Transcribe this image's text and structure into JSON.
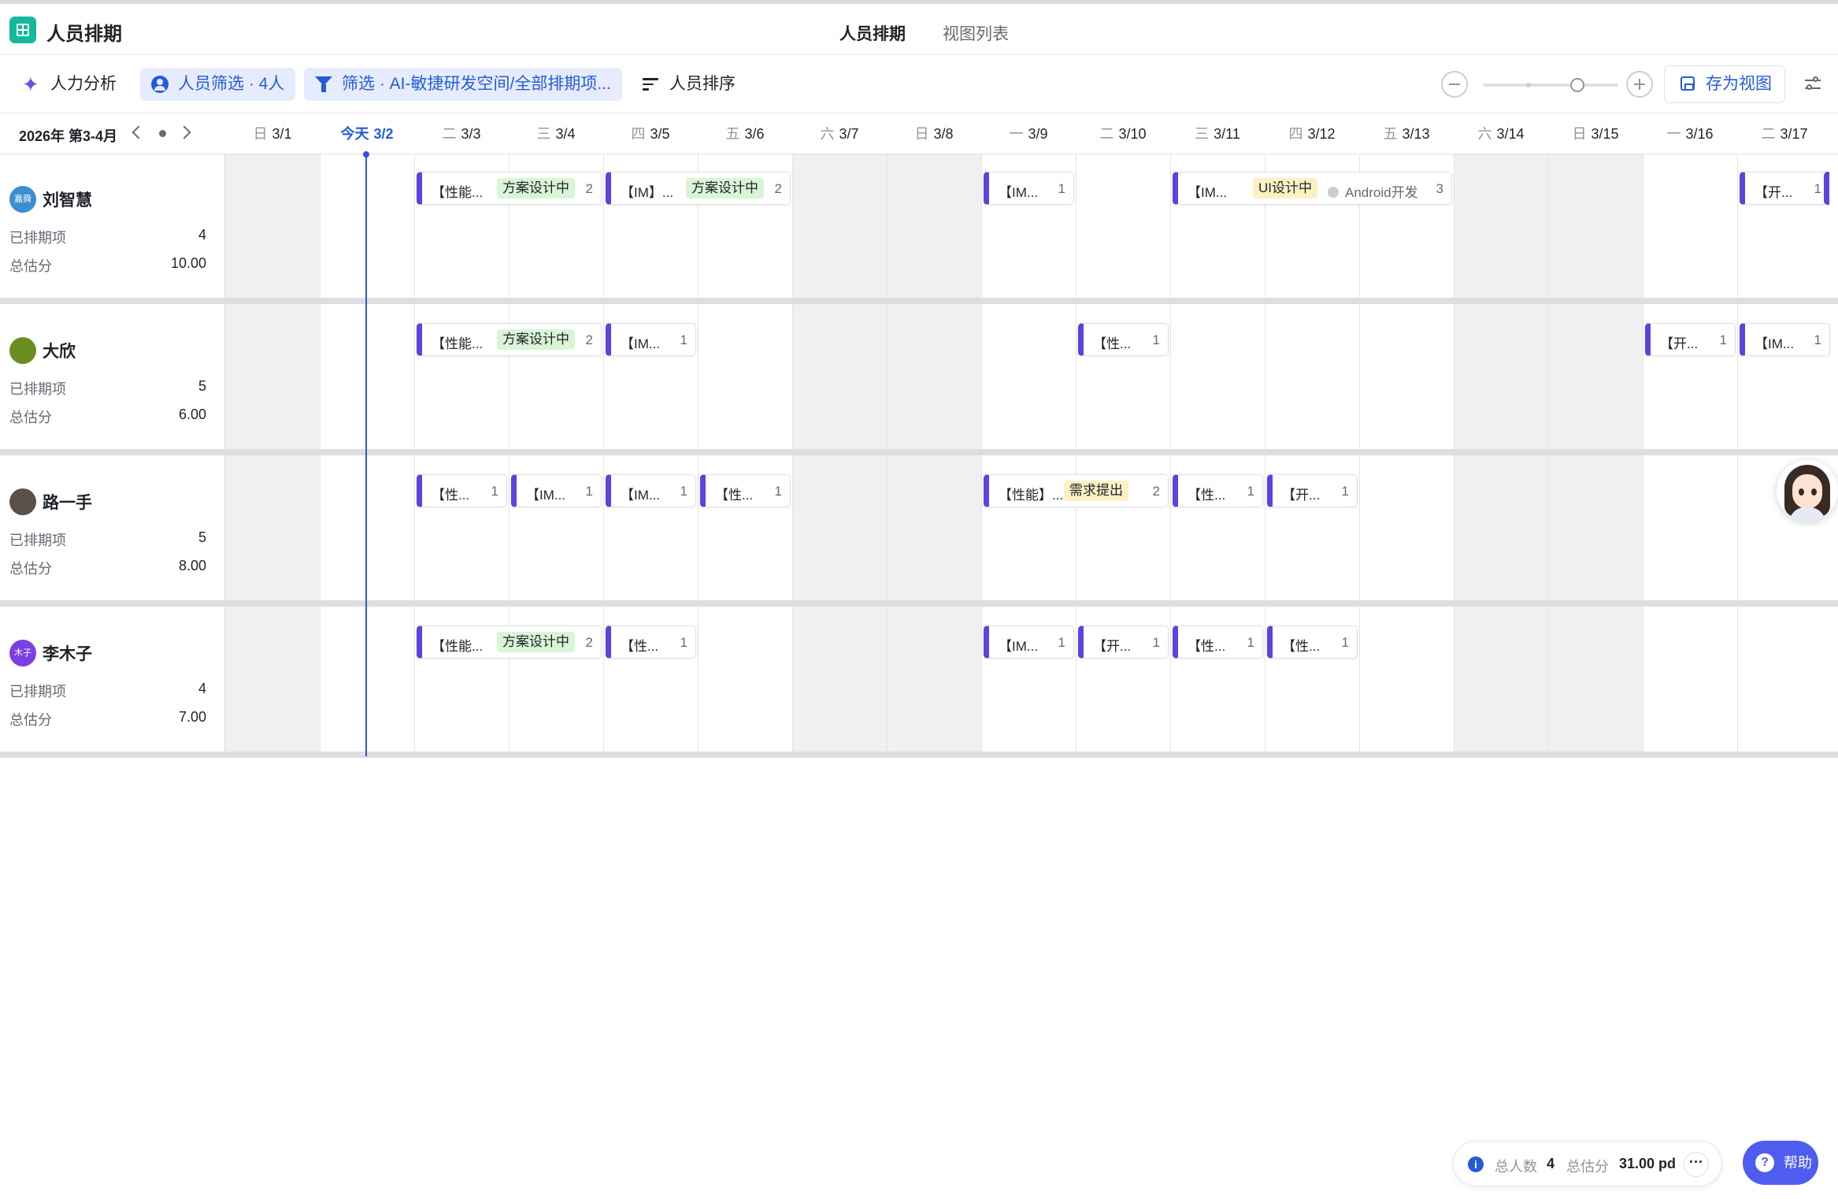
{
  "app": {
    "title": "人员排期",
    "logo_icon": "table-grid-icon",
    "accent": "#15b89a"
  },
  "top_tabs": {
    "schedule": "人员排期",
    "view_list": "视图列表"
  },
  "toolbar": {
    "analysis": "人力分析",
    "people_filter": "人员筛选 · 4人",
    "filter": "筛选 · AI-敏捷研发空间/全部排期项...",
    "sort": "人员排序",
    "save_view": "存为视图",
    "zoom_level": 0.7
  },
  "header": {
    "period": "2026年 第3-4月",
    "days": [
      {
        "wd": "日",
        "date": "3/1",
        "weekend": true
      },
      {
        "wd": "今天",
        "date": "3/2",
        "weekend": false,
        "today": true
      },
      {
        "wd": "二",
        "date": "3/3",
        "weekend": false
      },
      {
        "wd": "三",
        "date": "3/4",
        "weekend": false
      },
      {
        "wd": "四",
        "date": "3/5",
        "weekend": false
      },
      {
        "wd": "五",
        "date": "3/6",
        "weekend": false
      },
      {
        "wd": "六",
        "date": "3/7",
        "weekend": true
      },
      {
        "wd": "日",
        "date": "3/8",
        "weekend": true
      },
      {
        "wd": "一",
        "date": "3/9",
        "weekend": false
      },
      {
        "wd": "二",
        "date": "3/10",
        "weekend": false
      },
      {
        "wd": "三",
        "date": "3/11",
        "weekend": false
      },
      {
        "wd": "四",
        "date": "3/12",
        "weekend": false
      },
      {
        "wd": "五",
        "date": "3/13",
        "weekend": false
      },
      {
        "wd": "六",
        "date": "3/14",
        "weekend": true
      },
      {
        "wd": "日",
        "date": "3/15",
        "weekend": true
      },
      {
        "wd": "一",
        "date": "3/16",
        "weekend": false
      },
      {
        "wd": "二",
        "date": "3/17",
        "weekend": false
      }
    ]
  },
  "stat_labels": {
    "scheduled": "已排期项",
    "total_points": "总估分"
  },
  "people": [
    {
      "name": "刘智慧",
      "avatar_text": "嘉舜",
      "avatar_color": "#3a8fd0",
      "scheduled": "4",
      "points": "10.00",
      "tasks": [
        {
          "start": 2,
          "span": 2,
          "title": "【性能...",
          "tag": "方案设计中",
          "tag_color": "green",
          "count": "2"
        },
        {
          "start": 4,
          "span": 2,
          "title": "【IM】...",
          "tag": "方案设计中",
          "tag_color": "green",
          "count": "2"
        },
        {
          "start": 8,
          "span": 1,
          "title": "【IM...",
          "count": "1"
        },
        {
          "start": 10,
          "span": 3,
          "title": "【IM...",
          "tag": "UI设计中",
          "tag_color": "yellow",
          "extra": "Android开发",
          "count": "3"
        },
        {
          "start": 16,
          "span": 1,
          "title": "【开...",
          "count": "1"
        }
      ]
    },
    {
      "name": "大欣",
      "avatar_text": "",
      "avatar_color": "#6b8e23",
      "scheduled": "5",
      "points": "6.00",
      "tasks": [
        {
          "start": 2,
          "span": 2,
          "title": "【性能...",
          "tag": "方案设计中",
          "tag_color": "green",
          "count": "2"
        },
        {
          "start": 4,
          "span": 1,
          "title": "【IM...",
          "count": "1"
        },
        {
          "start": 9,
          "span": 1,
          "title": "【性...",
          "count": "1"
        },
        {
          "start": 15,
          "span": 1,
          "title": "【开...",
          "count": "1"
        },
        {
          "start": 16,
          "span": 1,
          "title": "【IM...",
          "count": "1"
        }
      ]
    },
    {
      "name": "路一手",
      "avatar_text": "",
      "avatar_color": "#5a5148",
      "scheduled": "5",
      "points": "8.00",
      "tasks": [
        {
          "start": 2,
          "span": 1,
          "title": "【性...",
          "count": "1"
        },
        {
          "start": 3,
          "span": 1,
          "title": "【IM...",
          "count": "1"
        },
        {
          "start": 4,
          "span": 1,
          "title": "【IM...",
          "count": "1"
        },
        {
          "start": 5,
          "span": 1,
          "title": "【性...",
          "count": "1"
        },
        {
          "start": 8,
          "span": 2,
          "title": "【性能】...",
          "tag": "需求提出",
          "tag_color": "yellow",
          "count": "2"
        },
        {
          "start": 10,
          "span": 1,
          "title": "【性...",
          "count": "1"
        },
        {
          "start": 11,
          "span": 1,
          "title": "【开...",
          "count": "1"
        }
      ]
    },
    {
      "name": "李木子",
      "avatar_text": "木子",
      "avatar_color": "#7b3fe4",
      "scheduled": "4",
      "points": "7.00",
      "tasks": [
        {
          "start": 2,
          "span": 2,
          "title": "【性能...",
          "tag": "方案设计中",
          "tag_color": "green",
          "count": "2"
        },
        {
          "start": 4,
          "span": 1,
          "title": "【性...",
          "count": "1"
        },
        {
          "start": 8,
          "span": 1,
          "title": "【IM...",
          "count": "1"
        },
        {
          "start": 9,
          "span": 1,
          "title": "【开...",
          "count": "1"
        },
        {
          "start": 10,
          "span": 1,
          "title": "【性...",
          "count": "1"
        },
        {
          "start": 11,
          "span": 1,
          "title": "【性...",
          "count": "1"
        }
      ]
    }
  ],
  "footer": {
    "total_people_label": "总人数",
    "total_people": "4",
    "total_points_label": "总估分",
    "total_points": "31.00 pd",
    "more": "···",
    "help": "帮助",
    "help_glyph": "?",
    "info_glyph": "i"
  }
}
